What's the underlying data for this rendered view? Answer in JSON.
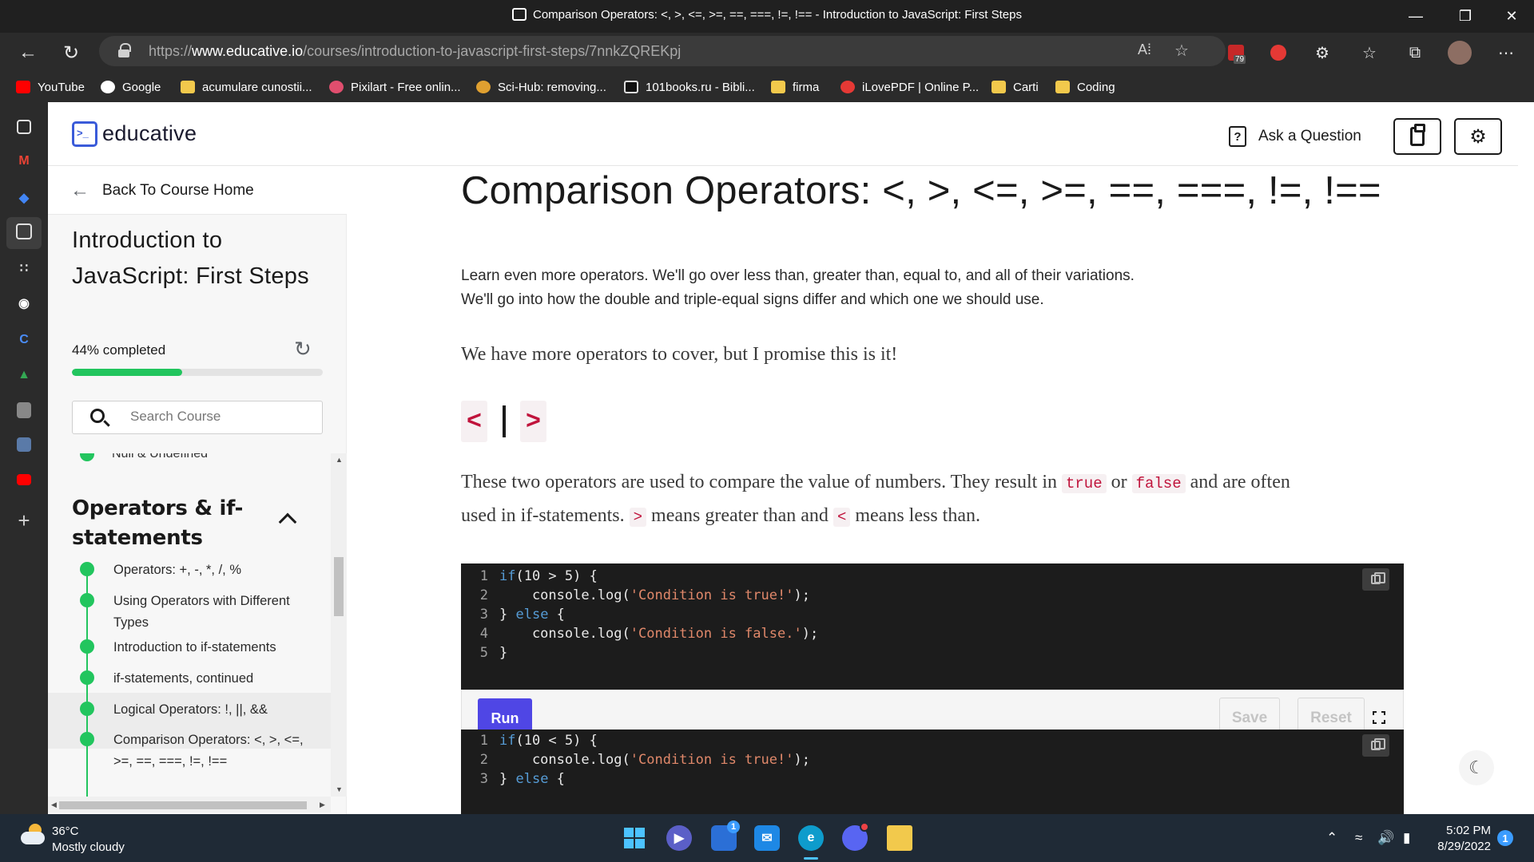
{
  "window": {
    "title": "Comparison Operators: <, >, <=, >=, ==, ===, !=, !== - Introduction to JavaScript: First Steps"
  },
  "addressbar": {
    "url_prefix": "https://",
    "url_domain": "www.educative.io",
    "url_path": "/courses/introduction-to-javascript-first-steps/7nnkZQREKpj",
    "extension_badge": "79"
  },
  "bookmarks": [
    {
      "label": "YouTube",
      "icon": "youtube-icon"
    },
    {
      "label": "Google",
      "icon": "google-icon"
    },
    {
      "label": "acumulare cunostii...",
      "icon": "folder-icon"
    },
    {
      "label": "Pixilart - Free onlin...",
      "icon": "heart-icon"
    },
    {
      "label": "Sci-Hub: removing...",
      "icon": "raven-icon"
    },
    {
      "label": "101books.ru - Bibli...",
      "icon": "book-icon"
    },
    {
      "label": "firma",
      "icon": "folder-icon"
    },
    {
      "label": "iLovePDF | Online P...",
      "icon": "heart-icon"
    },
    {
      "label": "Carti",
      "icon": "folder-icon"
    },
    {
      "label": "Coding",
      "icon": "folder-icon"
    }
  ],
  "header": {
    "logo_text": "educative",
    "ask_label": "Ask a Question"
  },
  "sidebar": {
    "back_label": "Back To Course Home",
    "course_title": "Introduction to JavaScript: First Steps",
    "progress_label": "44% completed",
    "progress_value": 0.44,
    "search_placeholder": "Search Course",
    "cut_item": "Null & Undefined",
    "section_title": "Operators & if-statements",
    "items": [
      {
        "label": "Operators: +, -, *, /, %"
      },
      {
        "label": "Using Operators with Different Types"
      },
      {
        "label": "Introduction to if-statements"
      },
      {
        "label": "if-statements, continued"
      },
      {
        "label": "Logical Operators: !, ||, &&"
      },
      {
        "label": "Comparison Operators: <, >, <=, >=, ==, ===, !=, !=="
      }
    ]
  },
  "lesson": {
    "title": "Comparison Operators: <, >, <=, >=, ==, ===, !=, !==",
    "summary_1": "Learn even more operators. We'll go over less than, greater than, equal to, and all of their variations.",
    "summary_2": "We'll go into how the double and triple-equal signs differ and which one we should use.",
    "intro": "We have more operators to cover, but I promise this is it!",
    "op_left": "<",
    "op_right": ">",
    "para_part1": "These two operators are used to compare the value of numbers. They result in ",
    "code_true": "true",
    "para_or": " or ",
    "code_false": "false",
    "para_part2": " and are often",
    "para_line2a": "used in if-statements. ",
    "code_gt": ">",
    "para_line2b": " means greater than and ",
    "code_lt": "<",
    "para_line2c": " means less than."
  },
  "code1": {
    "lines": [
      {
        "n": "1",
        "a": "if",
        "b": "(10 > 5) {"
      },
      {
        "n": "2",
        "a": "    console.log(",
        "s": "'Condition is true!'",
        "c": ");"
      },
      {
        "n": "3",
        "a": "} ",
        "k": "else",
        "b": " {"
      },
      {
        "n": "4",
        "a": "    console.log(",
        "s": "'Condition is false.'",
        "c": ");"
      },
      {
        "n": "5",
        "a": "}"
      }
    ]
  },
  "code2": {
    "lines": [
      {
        "n": "1",
        "a": "if",
        "b": "(10 < 5) {"
      },
      {
        "n": "2",
        "a": "    console.log(",
        "s": "'Condition is true!'",
        "c": ");"
      },
      {
        "n": "3",
        "a": "} ",
        "k": "else",
        "b": " {"
      }
    ]
  },
  "runbar": {
    "run_label": "Run",
    "save_label": "Save",
    "reset_label": "Reset"
  },
  "taskbar": {
    "temperature": "36°C",
    "weather": "Mostly cloudy",
    "time": "5:02 PM",
    "date": "8/29/2022",
    "notifications": "1",
    "mail_badge": "1"
  },
  "colors": {
    "accent": "#4f46e5",
    "progress": "#22c55e",
    "inline_code": "#c0143c"
  }
}
